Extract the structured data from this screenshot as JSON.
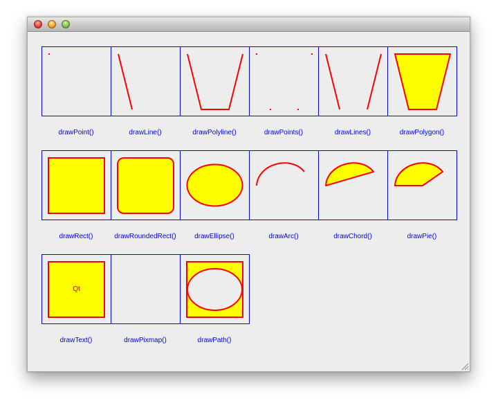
{
  "window": {
    "title": "",
    "controls": [
      "close",
      "minimize",
      "zoom"
    ]
  },
  "colors": {
    "border": "#0000ff",
    "pen": "#ff0000",
    "fill": "#ffff00",
    "caption": "#0000ff",
    "background": "#ededed"
  },
  "shapes": [
    {
      "label": "drawPoint()"
    },
    {
      "label": "drawLine()"
    },
    {
      "label": "drawPolyline()"
    },
    {
      "label": "drawPoints()"
    },
    {
      "label": "drawLines()"
    },
    {
      "label": "drawPolygon()"
    },
    {
      "label": "drawRect()"
    },
    {
      "label": "drawRoundedRect()"
    },
    {
      "label": "drawEllipse()"
    },
    {
      "label": "drawArc()"
    },
    {
      "label": "drawChord()"
    },
    {
      "label": "drawPie()"
    },
    {
      "label": "drawText()",
      "text": "Qt"
    },
    {
      "label": "drawPixmap()"
    },
    {
      "label": "drawPath()"
    }
  ]
}
